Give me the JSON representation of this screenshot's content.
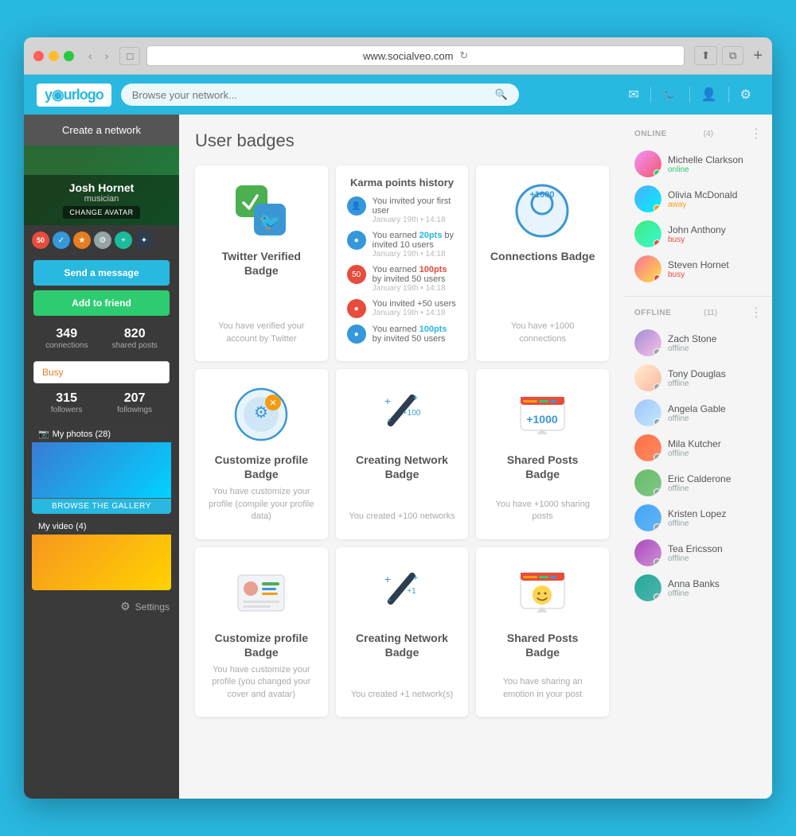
{
  "browser": {
    "url": "www.socialveo.com",
    "tab_icon": "□"
  },
  "nav": {
    "logo": "y◉urlogo",
    "search_placeholder": "Browse your network...",
    "icons": [
      "✉",
      "🐦",
      "👤",
      "⚙"
    ]
  },
  "sidebar": {
    "create_network": "Create a network",
    "profile": {
      "name": "Josh Hornet",
      "title": "musician",
      "change_avatar": "CHANGE AVATAR"
    },
    "stats": {
      "connections": "349",
      "connections_label": "connections",
      "shared_posts": "820",
      "shared_posts_label": "shared posts"
    },
    "status": "Busy",
    "followers": "315",
    "followers_label": "followers",
    "followings": "207",
    "followings_label": "followings",
    "photos_header": "My photos (28)",
    "browse_gallery": "BROWSE THE GALLERY",
    "videos_header": "My video (4)",
    "settings_label": "Settings",
    "send_message": "Send a message",
    "add_friend": "Add to friend"
  },
  "main": {
    "title": "User badges",
    "badges": [
      {
        "id": "twitter-verified",
        "title": "Twitter Verified Badge",
        "description": "You have verified your account by Twitter"
      },
      {
        "id": "karma-history",
        "title": "Karma points history",
        "items": [
          {
            "text": "You invited your first user",
            "date": "January 19th - 14:18",
            "color": "blue"
          },
          {
            "text": "You earned 20pts by invited 10 users",
            "pts": "20pts",
            "date": "January 19th - 14:18",
            "color": "blue"
          },
          {
            "text": "You earned 100pts by invited 50 users",
            "pts": "100pts",
            "date": "January 19th - 14:18",
            "color": "red"
          },
          {
            "text": "You invited +50 users",
            "date": "January 19th - 14:18",
            "color": "red"
          },
          {
            "text": "You earned 100pts by invited 50 users",
            "pts": "100pts",
            "color": "blue"
          }
        ]
      },
      {
        "id": "connections",
        "title": "Connections Badge",
        "description": "You have +1000 connections"
      },
      {
        "id": "customize-profile-1",
        "title": "Customize profile Badge",
        "description": "You have customize your profile (compile your profile data)"
      },
      {
        "id": "creating-network-1",
        "title": "Creating Network Badge",
        "description": "You created +100 networks"
      },
      {
        "id": "shared-posts-1",
        "title": "Shared Posts Badge",
        "description": "You have +1000 sharing posts"
      },
      {
        "id": "customize-profile-2",
        "title": "Customize profile Badge",
        "description": "You have customize your profile (you changed your cover and avatar)"
      },
      {
        "id": "creating-network-2",
        "title": "Creating Network Badge",
        "description": "You created +1 network(s)"
      },
      {
        "id": "shared-posts-2",
        "title": "Shared Posts Badge",
        "description": "You have sharing an emotion in your post"
      }
    ]
  },
  "online_users": {
    "section_label": "ONLINE",
    "count": "(4)",
    "users": [
      {
        "name": "Michelle Clarkson",
        "status": "online",
        "status_label": "online",
        "av": "av-1"
      },
      {
        "name": "Olivia McDonald",
        "status": "away",
        "status_label": "away",
        "av": "av-2"
      },
      {
        "name": "John Anthony",
        "status": "busy",
        "status_label": "busy",
        "av": "av-3"
      },
      {
        "name": "Steven Hornet",
        "status": "busy",
        "status_label": "busy",
        "av": "av-4"
      }
    ]
  },
  "offline_users": {
    "section_label": "OFFLINE",
    "count": "(11)",
    "users": [
      {
        "name": "Zach Stone",
        "status": "offline",
        "status_label": "offline",
        "av": "av-5"
      },
      {
        "name": "Tony Douglas",
        "status": "offline",
        "status_label": "offline",
        "av": "av-6"
      },
      {
        "name": "Angela Gable",
        "status": "offline",
        "status_label": "offline",
        "av": "av-7"
      },
      {
        "name": "Mila Kutcher",
        "status": "offline",
        "status_label": "offline",
        "av": "av-8"
      },
      {
        "name": "Eric Calderone",
        "status": "offline",
        "status_label": "offline",
        "av": "av-9"
      },
      {
        "name": "Kristen Lopez",
        "status": "offline",
        "status_label": "offline",
        "av": "av-10"
      },
      {
        "name": "Tea Ericsson",
        "status": "offline",
        "status_label": "offline",
        "av": "av-11"
      },
      {
        "name": "Anna Banks",
        "status": "offline",
        "status_label": "offline",
        "av": "av-12"
      }
    ]
  }
}
